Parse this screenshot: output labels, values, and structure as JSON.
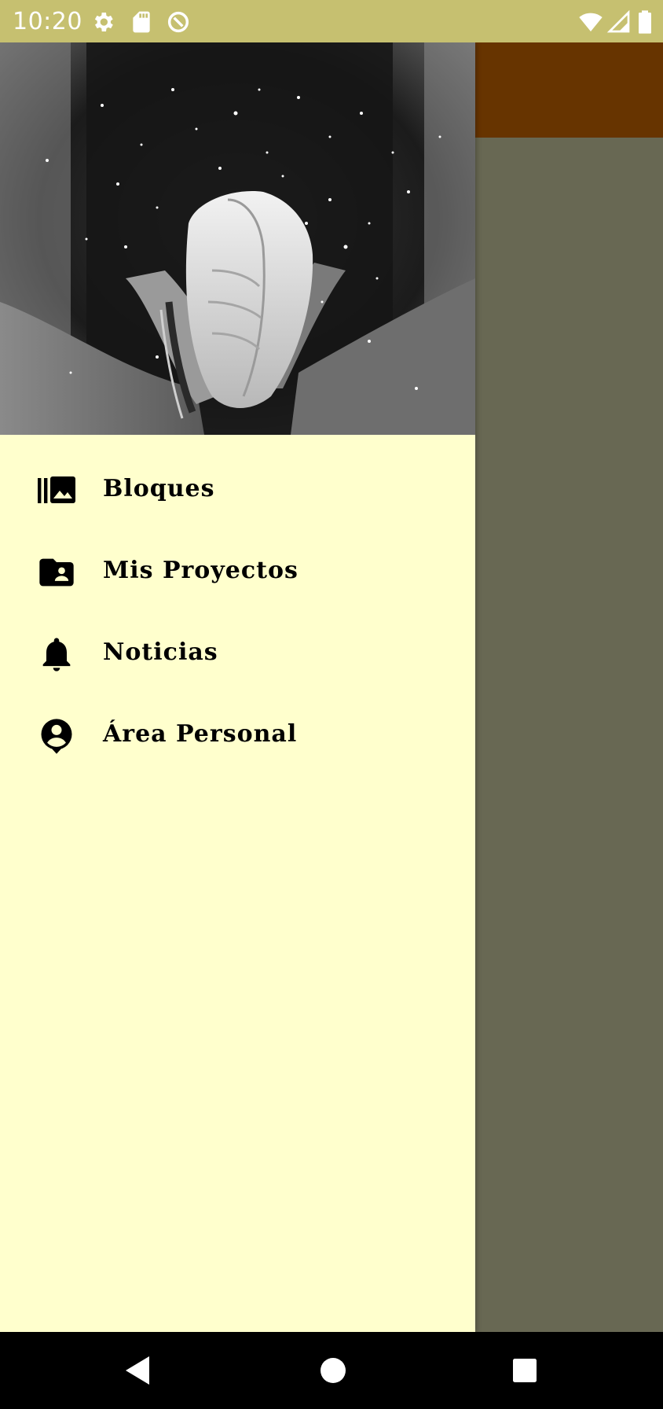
{
  "status_bar": {
    "time": "10:20",
    "left_icons": [
      "settings-icon",
      "sd-card-icon",
      "data-saver-icon"
    ],
    "right_icons": [
      "wifi-icon",
      "cell-signal-icon",
      "battery-icon"
    ],
    "background_color": "#c6c070"
  },
  "app": {
    "toolbar_color": "#673400",
    "content_scrim_color": "#686853"
  },
  "drawer": {
    "background_color": "#ffffcd",
    "header_image": "black-and-white photo of chalked hands clapping with dust particles",
    "items": [
      {
        "icon": "photo-library-icon",
        "label": "Bloques"
      },
      {
        "icon": "folder-shared-icon",
        "label": "Mis Proyectos"
      },
      {
        "icon": "notifications-bell-icon",
        "label": "Noticias"
      },
      {
        "icon": "account-pin-icon",
        "label": "Área Personal"
      }
    ]
  },
  "nav_bar": {
    "buttons": [
      "back-icon",
      "home-icon",
      "recents-icon"
    ]
  }
}
